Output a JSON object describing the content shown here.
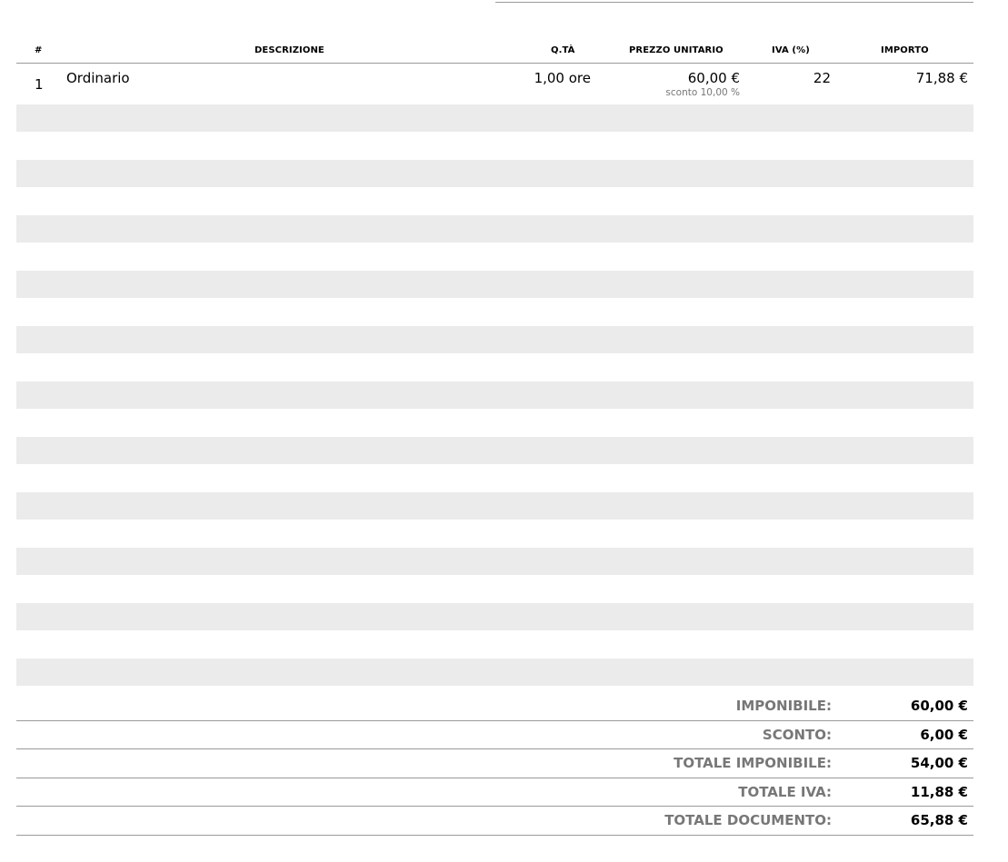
{
  "table": {
    "headers": {
      "number": "#",
      "description": "DESCRIZIONE",
      "quantity": "Q.TÀ",
      "unit_price": "PREZZO UNITARIO",
      "vat": "IVA (%)",
      "amount": "IMPORTO"
    },
    "rows": [
      {
        "number": "1",
        "description": "Ordinario",
        "quantity": "1,00 ore",
        "unit_price": "60,00 €",
        "discount": "sconto 10,00 %",
        "vat": "22",
        "amount": "71,88 €"
      }
    ]
  },
  "totals": [
    {
      "label": "IMPONIBILE:",
      "value": "60,00 €"
    },
    {
      "label": "SCONTO:",
      "value": "6,00 €"
    },
    {
      "label": "TOTALE IMPONIBILE:",
      "value": "54,00 €"
    },
    {
      "label": "TOTALE IVA:",
      "value": "11,88 €"
    },
    {
      "label": "TOTALE DOCUMENTO:",
      "value": "65,88 €"
    }
  ]
}
